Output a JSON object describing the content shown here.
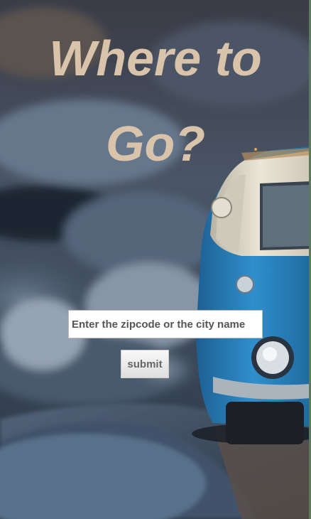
{
  "hero": {
    "title_line1": "Where to",
    "title_line2": "Go?"
  },
  "search": {
    "placeholder": "Enter the zipcode or the city name",
    "value": ""
  },
  "submit": {
    "label": "submit"
  },
  "colors": {
    "title": "#d9c4ab",
    "van_body": "#2f86c0",
    "van_top": "#e8e1d2"
  }
}
